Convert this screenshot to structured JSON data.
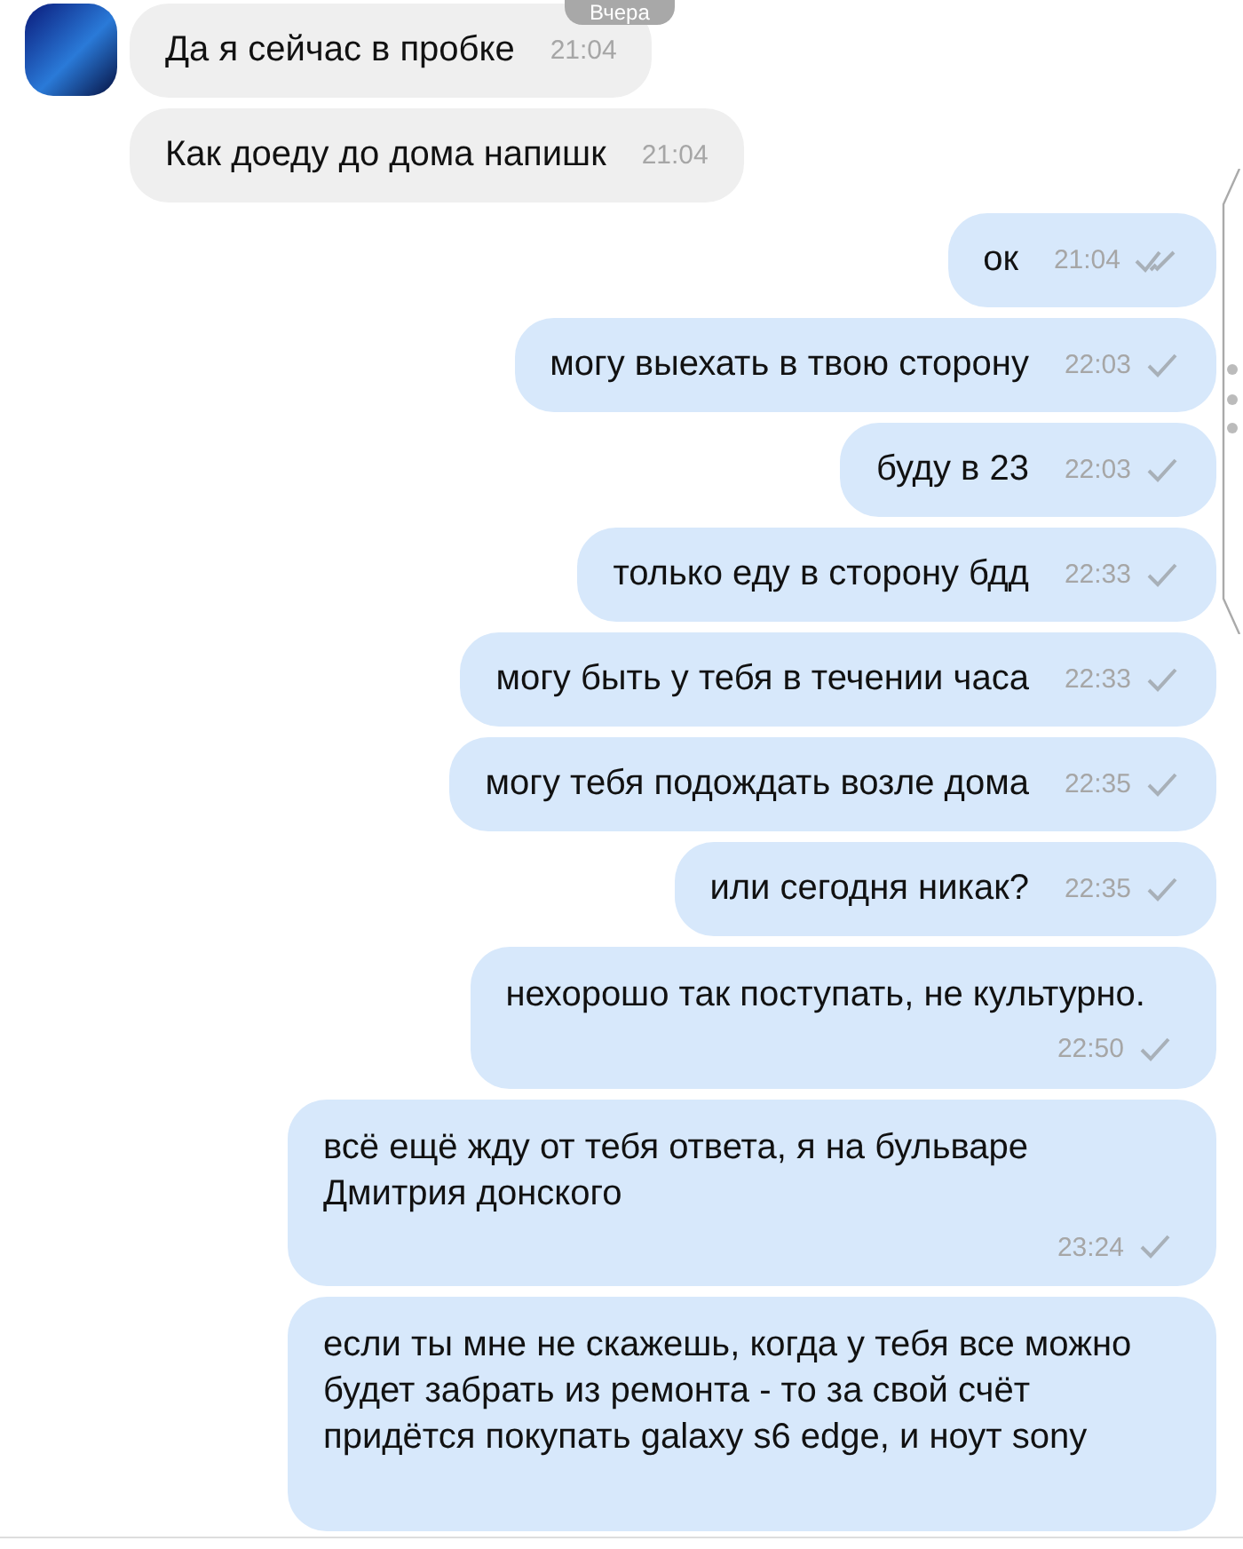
{
  "date_pill": "Вчера",
  "messages": [
    {
      "outgoing": false,
      "kind": "inline",
      "avatar": true,
      "text": "Да я сейчас в пробке",
      "time": "21:04"
    },
    {
      "outgoing": false,
      "kind": "inline",
      "text": "Как доеду до дома напишк",
      "time": "21:04"
    },
    {
      "outgoing": true,
      "kind": "inline",
      "text": "ок",
      "time": "21:04",
      "read": true
    },
    {
      "outgoing": true,
      "kind": "inline",
      "text": "могу выехать в твою сторону",
      "time": "22:03",
      "read": false
    },
    {
      "outgoing": true,
      "kind": "inline",
      "text": "буду в 23",
      "time": "22:03",
      "read": false
    },
    {
      "outgoing": true,
      "kind": "inline",
      "text": "только еду в сторону бдд",
      "time": "22:33",
      "read": false
    },
    {
      "outgoing": true,
      "kind": "inline",
      "text": "могу быть у тебя в течении часа",
      "time": "22:33",
      "read": false
    },
    {
      "outgoing": true,
      "kind": "inline",
      "text": "могу тебя подождать возле дома",
      "time": "22:35",
      "read": false
    },
    {
      "outgoing": true,
      "kind": "inline",
      "text": "или сегодня никак?",
      "time": "22:35",
      "read": false
    },
    {
      "outgoing": true,
      "kind": "stacked",
      "text": "нехорошо так поступать, не культурно.",
      "time": "22:50",
      "read": false
    },
    {
      "outgoing": true,
      "kind": "stacked",
      "text": "всё ещё жду от тебя ответа, я на бульваре Дмитрия донского",
      "time": "23:24",
      "read": false
    },
    {
      "outgoing": true,
      "kind": "stacked",
      "text": "если ты мне не скажешь, когда у тебя все можно будет забрать из ремонта - то за свой счёт придётся покупать galaxy s6 edge, и ноут sony"
    }
  ]
}
